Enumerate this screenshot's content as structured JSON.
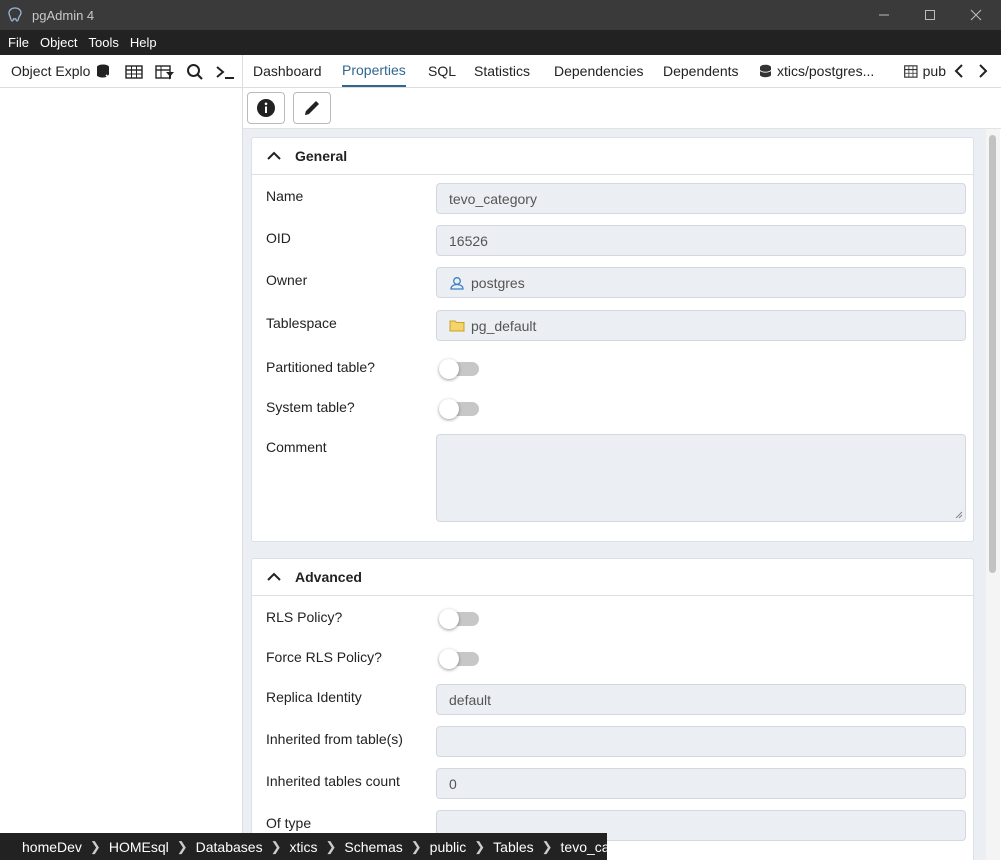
{
  "window": {
    "title": "pgAdmin 4"
  },
  "menu": [
    "File",
    "Object",
    "Tools",
    "Help"
  ],
  "object_explorer": {
    "title": "Object Explorer"
  },
  "tabs": [
    {
      "label": "Dashboard"
    },
    {
      "label": "Properties"
    },
    {
      "label": "SQL"
    },
    {
      "label": "Statistics"
    },
    {
      "label": "Dependencies"
    },
    {
      "label": "Dependents"
    },
    {
      "label": "xtics/postgres..."
    },
    {
      "label": "pub"
    }
  ],
  "general": {
    "title": "General",
    "name_label": "Name",
    "name_value": "tevo_category",
    "oid_label": "OID",
    "oid_value": "16526",
    "owner_label": "Owner",
    "owner_value": "postgres",
    "tablespace_label": "Tablespace",
    "tablespace_value": "pg_default",
    "partitioned_label": "Partitioned table?",
    "system_label": "System table?",
    "comment_label": "Comment"
  },
  "advanced": {
    "title": "Advanced",
    "rls_label": "RLS Policy?",
    "force_rls_label": "Force RLS Policy?",
    "replica_label": "Replica Identity",
    "replica_value": "default",
    "inherited_label": "Inherited from table(s)",
    "inherited_value": "",
    "inherited_count_label": "Inherited tables count",
    "inherited_count_value": "0",
    "of_type_label": "Of type",
    "of_type_value": ""
  },
  "breadcrumb": [
    "homeDev",
    "HOMEsql",
    "Databases",
    "xtics",
    "Schemas",
    "public",
    "Tables",
    "tevo_category"
  ],
  "colors": {
    "accent": "#326690",
    "titlebar": "#3a3a3a",
    "menubar": "#222222",
    "field_bg": "#ebeef3"
  }
}
